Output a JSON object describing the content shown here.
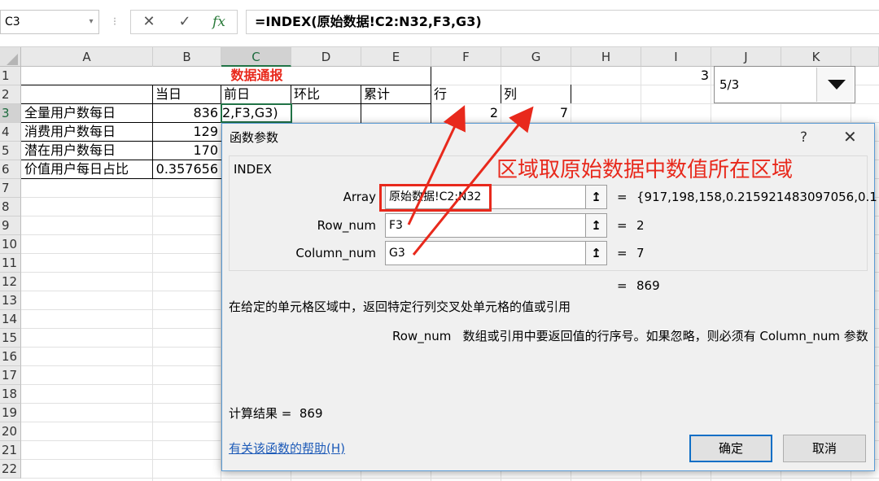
{
  "formula_bar": {
    "name_box": "C3",
    "separator": "⁝",
    "cancel_glyph": "✕",
    "enter_glyph": "✓",
    "fx_label": "fx",
    "formula": "=INDEX(原始数据!C2:N32,F3,G3)"
  },
  "columns": [
    "A",
    "B",
    "C",
    "D",
    "E",
    "F",
    "G",
    "H",
    "I",
    "J",
    "K"
  ],
  "rows": [
    "1",
    "2",
    "3",
    "4",
    "5",
    "6",
    "7",
    "8",
    "9",
    "10",
    "11",
    "12",
    "13",
    "14",
    "15",
    "16",
    "17",
    "18",
    "19",
    "20",
    "21",
    "22"
  ],
  "selected": {
    "column": "C",
    "row": "3"
  },
  "sheet": {
    "c1_title": "数据通报",
    "b2": "当日",
    "c2": "前日",
    "d2": "环比",
    "e2": "累计",
    "f2": "行",
    "g2": "列",
    "a3": "全量用户数每日",
    "b3": "836",
    "c3": "2,F3,G3)",
    "f3": "2",
    "g3": "7",
    "i1": "3",
    "a4": "消费用户数每日",
    "b4": "129",
    "a5": "潜在用户数每日",
    "b5": "170",
    "a6": "价值用户每日占比",
    "b6": "0.357656"
  },
  "dropdown": {
    "value": "5/3",
    "icon": "triangle-down"
  },
  "dialog": {
    "title": "函数参数",
    "help_glyph": "?",
    "close_glyph": "✕",
    "function_name": "INDEX",
    "params": [
      {
        "label": "Array",
        "value": "原始数据!C2:N32",
        "result": "{917,198,158,0.215921483097056,0.1"
      },
      {
        "label": "Row_num",
        "value": "F3",
        "result": "2"
      },
      {
        "label": "Column_num",
        "value": "G3",
        "result": "7"
      }
    ],
    "ref_glyph": "↥",
    "equals": "=",
    "overall_result": "869",
    "description": "在给定的单元格区域中，返回特定行列交叉处单元格的值或引用",
    "arg_name": "Row_num",
    "arg_description": "数组或引用中要返回值的行序号。如果忽略，则必须有 Column_num 参数",
    "calc_label": "计算结果 =",
    "calc_value": "869",
    "help_link": "有关该函数的帮助(H)",
    "ok_label": "确定",
    "cancel_label": "取消"
  },
  "annotation": {
    "text": "区域取原始数据中数值所在区域",
    "color": "#e8291c"
  },
  "colors": {
    "accent": "#217346",
    "title_red": "#e8291c",
    "link": "#1e5bb8"
  }
}
